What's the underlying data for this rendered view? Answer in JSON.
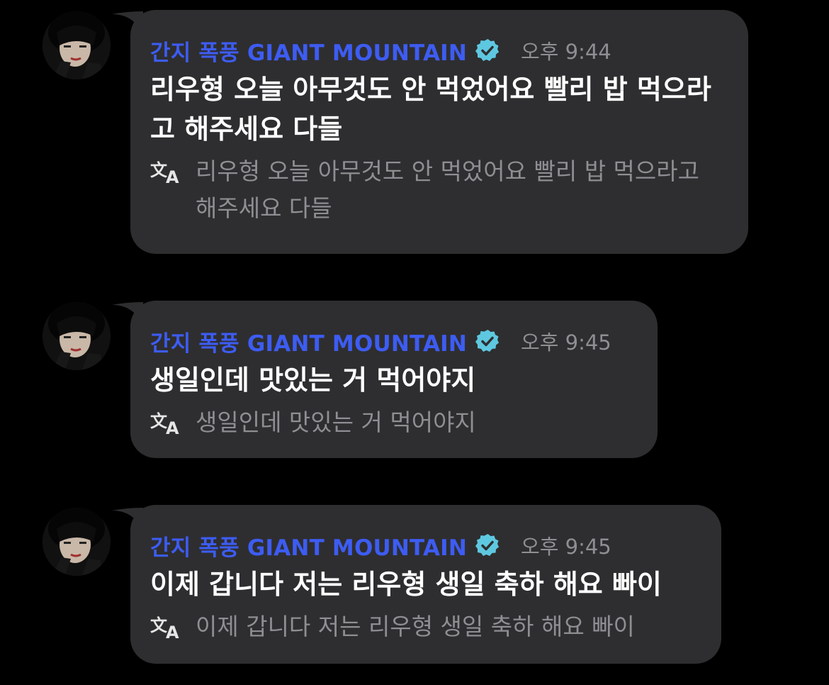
{
  "messages": [
    {
      "sender": "간지 폭풍 GIANT MOUNTAIN",
      "time": "오후 9:44",
      "text": "리우형 오늘 아무것도 안 먹었어요 빨리 밥 먹으라고 해주세요 다들",
      "translation": "리우형 오늘 아무것도 안 먹었어요 빨리 밥 먹으라고 해주세요 다들"
    },
    {
      "sender": "간지 폭풍 GIANT MOUNTAIN",
      "time": "오후 9:45",
      "text": "생일인데 맛있는 거 먹어야지",
      "translation": "생일인데 맛있는 거 먹어야지"
    },
    {
      "sender": "간지 폭풍 GIANT MOUNTAIN",
      "time": "오후 9:45",
      "text": "이제 갑니다 저는 리우형 생일 축하 해요 빠이",
      "translation": "이제 갑니다 저는 리우형 생일 축하 해요 빠이"
    }
  ],
  "colors": {
    "background": "#000000",
    "bubble": "#2e2e30",
    "sender": "#3d5cf2",
    "verified_badge": "#5ec8e0",
    "muted": "#8e8e93",
    "text": "#ffffff"
  },
  "icons": {
    "avatar": "user-avatar-photo",
    "verified": "verified-badge-icon",
    "translate": "translate-icon"
  }
}
